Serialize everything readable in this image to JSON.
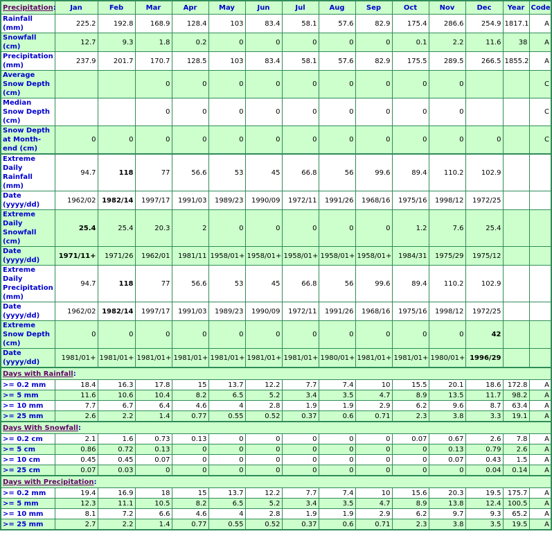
{
  "header": {
    "section_label": "Precipitation",
    "colon": ":",
    "columns": [
      "Jan",
      "Feb",
      "Mar",
      "Apr",
      "May",
      "Jun",
      "Jul",
      "Aug",
      "Sep",
      "Oct",
      "Nov",
      "Dec",
      "Year",
      "Code"
    ]
  },
  "main_rows": [
    {
      "label": "Rainfall (mm)",
      "values": [
        "225.2",
        "192.8",
        "168.9",
        "128.4",
        "103",
        "83.4",
        "58.1",
        "57.6",
        "82.9",
        "175.4",
        "286.6",
        "254.9",
        "1817.1",
        "A"
      ],
      "bold": []
    },
    {
      "label": "Snowfall (cm)",
      "values": [
        "12.7",
        "9.3",
        "1.8",
        "0.2",
        "0",
        "0",
        "0",
        "0",
        "0",
        "0.1",
        "2.2",
        "11.6",
        "38",
        "A"
      ],
      "bold": []
    },
    {
      "label": "Precipitation (mm)",
      "values": [
        "237.9",
        "201.7",
        "170.7",
        "128.5",
        "103",
        "83.4",
        "58.1",
        "57.6",
        "82.9",
        "175.5",
        "289.5",
        "266.5",
        "1855.2",
        "A"
      ],
      "bold": []
    },
    {
      "label": "Average Snow Depth (cm)",
      "values": [
        "",
        "",
        "0",
        "0",
        "0",
        "0",
        "0",
        "0",
        "0",
        "0",
        "0",
        "",
        "",
        "C"
      ],
      "bold": []
    },
    {
      "label": "Median Snow Depth (cm)",
      "values": [
        "",
        "",
        "0",
        "0",
        "0",
        "0",
        "0",
        "0",
        "0",
        "0",
        "0",
        "",
        "",
        "C"
      ],
      "bold": []
    },
    {
      "label": "Snow Depth at Month-end (cm)",
      "values": [
        "0",
        "0",
        "0",
        "0",
        "0",
        "0",
        "0",
        "0",
        "0",
        "0",
        "0",
        "0",
        "",
        "C"
      ],
      "bold": []
    },
    {
      "label": "Extreme Daily Rainfall (mm)",
      "values": [
        "94.7",
        "118",
        "77",
        "56.6",
        "53",
        "45",
        "66.8",
        "56",
        "99.6",
        "89.4",
        "110.2",
        "102.9",
        "",
        ""
      ],
      "bold": [
        1
      ]
    },
    {
      "label": "Date (yyyy/dd)",
      "values": [
        "1962/02",
        "1982/14",
        "1997/17",
        "1991/03",
        "1989/23",
        "1990/09",
        "1972/11",
        "1991/26",
        "1968/16",
        "1975/16",
        "1998/12",
        "1972/25",
        "",
        ""
      ],
      "bold": [
        1
      ]
    },
    {
      "label": "Extreme Daily Snowfall (cm)",
      "values": [
        "25.4",
        "25.4",
        "20.3",
        "2",
        "0",
        "0",
        "0",
        "0",
        "0",
        "1.2",
        "7.6",
        "25.4",
        "",
        ""
      ],
      "bold": [
        0
      ]
    },
    {
      "label": "Date (yyyy/dd)",
      "values": [
        "1971/11+",
        "1971/26",
        "1962/01",
        "1981/11",
        "1958/01+",
        "1958/01+",
        "1958/01+",
        "1958/01+",
        "1958/01+",
        "1984/31",
        "1975/29",
        "1975/12",
        "",
        ""
      ],
      "bold": [
        0
      ]
    },
    {
      "label": "Extreme Daily Precipitation (mm)",
      "values": [
        "94.7",
        "118",
        "77",
        "56.6",
        "53",
        "45",
        "66.8",
        "56",
        "99.6",
        "89.4",
        "110.2",
        "102.9",
        "",
        ""
      ],
      "bold": [
        1
      ]
    },
    {
      "label": "Date (yyyy/dd)",
      "values": [
        "1962/02",
        "1982/14",
        "1997/17",
        "1991/03",
        "1989/23",
        "1990/09",
        "1972/11",
        "1991/26",
        "1968/16",
        "1975/16",
        "1998/12",
        "1972/25",
        "",
        ""
      ],
      "bold": [
        1
      ]
    },
    {
      "label": "Extreme Snow Depth (cm)",
      "values": [
        "0",
        "0",
        "0",
        "0",
        "0",
        "0",
        "0",
        "0",
        "0",
        "0",
        "0",
        "42",
        "",
        ""
      ],
      "bold": [
        11
      ]
    },
    {
      "label": "Date (yyyy/dd)",
      "values": [
        "1981/01+",
        "1981/01+",
        "1981/01+",
        "1981/01+",
        "1981/01+",
        "1981/01+",
        "1981/01+",
        "1980/01+",
        "1981/01+",
        "1981/01+",
        "1980/01+",
        "1996/29",
        "",
        ""
      ],
      "bold": [
        11
      ]
    }
  ],
  "sections": [
    {
      "title": "Days with Rainfall",
      "colon": ":",
      "rows": [
        {
          "label": ">= 0.2 mm",
          "values": [
            "18.4",
            "16.3",
            "17.8",
            "15",
            "13.7",
            "12.2",
            "7.7",
            "7.4",
            "10",
            "15.5",
            "20.1",
            "18.6",
            "172.8",
            "A"
          ]
        },
        {
          "label": ">= 5 mm",
          "values": [
            "11.6",
            "10.6",
            "10.4",
            "8.2",
            "6.5",
            "5.2",
            "3.4",
            "3.5",
            "4.7",
            "8.9",
            "13.5",
            "11.7",
            "98.2",
            "A"
          ]
        },
        {
          "label": ">= 10 mm",
          "values": [
            "7.7",
            "6.7",
            "6.4",
            "4.6",
            "4",
            "2.8",
            "1.9",
            "1.9",
            "2.9",
            "6.2",
            "9.6",
            "8.7",
            "63.4",
            "A"
          ]
        },
        {
          "label": ">= 25 mm",
          "values": [
            "2.6",
            "2.2",
            "1.4",
            "0.77",
            "0.55",
            "0.52",
            "0.37",
            "0.6",
            "0.71",
            "2.3",
            "3.8",
            "3.3",
            "19.1",
            "A"
          ]
        }
      ]
    },
    {
      "title": "Days With Snowfall",
      "colon": ":",
      "rows": [
        {
          "label": ">= 0.2 cm",
          "values": [
            "2.1",
            "1.6",
            "0.73",
            "0.13",
            "0",
            "0",
            "0",
            "0",
            "0",
            "0.07",
            "0.67",
            "2.6",
            "7.8",
            "A"
          ]
        },
        {
          "label": ">= 5 cm",
          "values": [
            "0.86",
            "0.72",
            "0.13",
            "0",
            "0",
            "0",
            "0",
            "0",
            "0",
            "0",
            "0.13",
            "0.79",
            "2.6",
            "A"
          ]
        },
        {
          "label": ">= 10 cm",
          "values": [
            "0.45",
            "0.45",
            "0.07",
            "0",
            "0",
            "0",
            "0",
            "0",
            "0",
            "0",
            "0.07",
            "0.43",
            "1.5",
            "A"
          ]
        },
        {
          "label": ">= 25 cm",
          "values": [
            "0.07",
            "0.03",
            "0",
            "0",
            "0",
            "0",
            "0",
            "0",
            "0",
            "0",
            "0",
            "0.04",
            "0.14",
            "A"
          ]
        }
      ]
    },
    {
      "title": "Days with Precipitation",
      "colon": ":",
      "rows": [
        {
          "label": ">= 0.2 mm",
          "values": [
            "19.4",
            "16.9",
            "18",
            "15",
            "13.7",
            "12.2",
            "7.7",
            "7.4",
            "10",
            "15.6",
            "20.3",
            "19.5",
            "175.7",
            "A"
          ]
        },
        {
          "label": ">= 5 mm",
          "values": [
            "12.3",
            "11.1",
            "10.5",
            "8.2",
            "6.5",
            "5.2",
            "3.4",
            "3.5",
            "4.7",
            "8.9",
            "13.8",
            "12.4",
            "100.5",
            "A"
          ]
        },
        {
          "label": ">= 10 mm",
          "values": [
            "8.1",
            "7.2",
            "6.6",
            "4.6",
            "4",
            "2.8",
            "1.9",
            "1.9",
            "2.9",
            "6.2",
            "9.7",
            "9.3",
            "65.2",
            "A"
          ]
        },
        {
          "label": ">= 25 mm",
          "values": [
            "2.7",
            "2.2",
            "1.4",
            "0.77",
            "0.55",
            "0.52",
            "0.37",
            "0.6",
            "0.71",
            "2.3",
            "3.8",
            "3.5",
            "19.5",
            "A"
          ]
        }
      ]
    }
  ],
  "colors": {
    "border": "#2e8b57",
    "green_row": "#ccffcc",
    "label_text": "#0000cc",
    "section_link": "#660066"
  }
}
